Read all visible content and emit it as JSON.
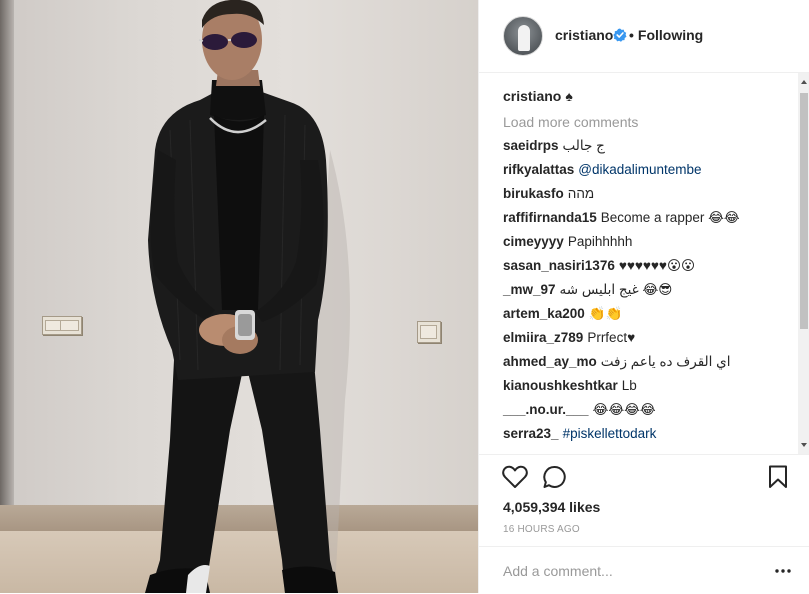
{
  "photo": {
    "alt_icon": "photo"
  },
  "header": {
    "username": "cristiano",
    "verified_icon": "verified-badge-icon",
    "follow_label": "Following",
    "separator": "•",
    "accent_color": "#3897f0"
  },
  "caption": {
    "username": "cristiano",
    "text": "♠"
  },
  "load_more": "Load more comments",
  "comments": [
    {
      "user": "saeidrps",
      "text": "ج جالب",
      "mention": false
    },
    {
      "user": "rifkyalattas",
      "text": "@dikadalimuntembe",
      "mention": true
    },
    {
      "user": "birukasfo",
      "text": "מהה",
      "mention": false
    },
    {
      "user": "raffifirnanda15",
      "text": "Become a rapper 😂😂",
      "mention": false
    },
    {
      "user": "cimeyyyy",
      "text": "Papihhhhh",
      "mention": false
    },
    {
      "user": "sasan_nasiri1376",
      "text": "♥♥♥♥♥♥😮😮",
      "mention": false
    },
    {
      "user": "_mw_97",
      "text": "غیج ابلیس شه 😂😎",
      "mention": false
    },
    {
      "user": "artem_ka200",
      "text": "👏👏",
      "mention": false
    },
    {
      "user": "elmiira_z789",
      "text": "Prrfect♥",
      "mention": false
    },
    {
      "user": "ahmed_ay_mo",
      "text": "اي القرف ده ياعم زفت",
      "mention": false
    },
    {
      "user": "kianoushkeshtkar",
      "text": "Lb",
      "mention": false
    },
    {
      "user": "___.no.ur.___",
      "text": "😂😂😂😂",
      "mention": false
    },
    {
      "user": "serra23_",
      "text": "#piskellettodark",
      "mention": true
    }
  ],
  "actions": {
    "like_icon": "heart-icon",
    "comment_icon": "comment-bubble-icon",
    "save_icon": "bookmark-icon"
  },
  "likes": "4,059,394 likes",
  "timestamp": "16 HOURS AGO",
  "add_comment": {
    "placeholder": "Add a comment...",
    "value": ""
  },
  "more_icon": "more-options-icon"
}
